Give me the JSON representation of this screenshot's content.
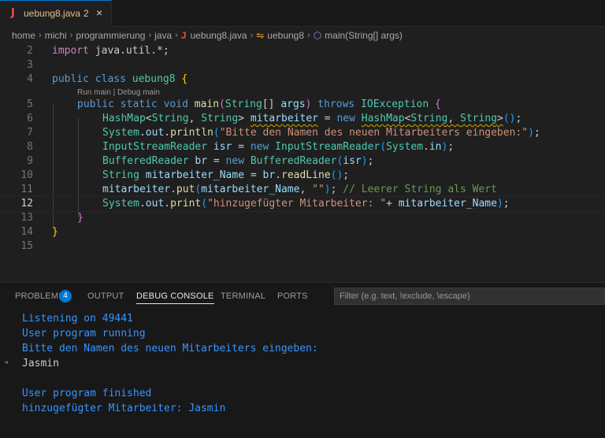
{
  "tab": {
    "icon": "J",
    "label": "uebung8.java",
    "badge": "2",
    "close": "×"
  },
  "breadcrumb": {
    "items": [
      "home",
      "michi",
      "programmierung",
      "java"
    ],
    "file_icon": "J",
    "file": "uebung8.java",
    "class": "uebung8",
    "method": "main(String[] args)"
  },
  "editor": {
    "line_numbers": [
      "2",
      "3",
      "4",
      "5",
      "6",
      "7",
      "8",
      "9",
      "10",
      "11",
      "12",
      "13",
      "14",
      "15"
    ],
    "active_line": "12",
    "codelens": "Run main | Debug main"
  },
  "code": {
    "l2": {
      "kw": "import",
      "rest": " java.util.*;"
    },
    "l4": {
      "kw1": "public",
      "kw2": "class",
      "name": "uebung8",
      "br": "{"
    },
    "l5": {
      "kw1": "public",
      "kw2": "static",
      "kw3": "void",
      "fn": "main",
      "p1": "(",
      "ty": "String",
      "arr": "[] ",
      "va": "args",
      "p2": ")",
      "kw4": "throws",
      "ex": "IOException",
      "br": "{"
    },
    "l6": {
      "ty1": "HashMap",
      "g1": "<",
      "ty2": "String",
      "c": ", ",
      "ty3": "String",
      "g2": "> ",
      "va": "mitarbeiter",
      "eq": " = ",
      "kw": "new",
      "ty4": "HashMap",
      "g3": "<",
      "ty5": "String",
      "c2": ", ",
      "ty6": "String",
      "g4": ">",
      "p": "()",
      "end": ";"
    },
    "l7": {
      "ty": "System",
      "d1": ".",
      "va": "out",
      "d2": ".",
      "fn": "println",
      "p1": "(",
      "st": "\"Bitte den Namen des neuen Mitarbeiters eingeben:\"",
      "p2": ")",
      "end": ";"
    },
    "l8": {
      "ty": "InputStreamReader",
      "va": " isr",
      "eq": " = ",
      "kw": "new",
      "ty2": " InputStreamReader",
      "p1": "(",
      "ty3": "System",
      "d": ".",
      "va2": "in",
      "p2": ")",
      "end": ";"
    },
    "l9": {
      "ty": "BufferedReader",
      "va": " br",
      "eq": " = ",
      "kw": "new",
      "ty2": " BufferedReader",
      "p1": "(",
      "va2": "isr",
      "p2": ")",
      "end": ";"
    },
    "l10": {
      "ty": "String",
      "va": " mitarbeiter_Name",
      "eq": " = ",
      "va2": "br",
      "d": ".",
      "fn": "readLine",
      "p": "()",
      "end": ";"
    },
    "l11": {
      "va": "mitarbeiter",
      "d": ".",
      "fn": "put",
      "p1": "(",
      "va2": "mitarbeiter_Name",
      "c": ", ",
      "st": "\"\"",
      "p2": ")",
      "end": ";",
      "cm": " // Leerer String als Wert"
    },
    "l12": {
      "ty": "System",
      "d1": ".",
      "va": "out",
      "d2": ".",
      "fn": "print",
      "p1": "(",
      "st": "\"hinzugefügter Mitarbeiter: \"",
      "plus": "+ ",
      "va2": "mitarbeiter_Name",
      "p2": ")",
      "end": ";"
    },
    "l13": {
      "br": "}"
    },
    "l14": {
      "br": "}"
    }
  },
  "panel": {
    "tabs": [
      "PROBLEMS",
      "OUTPUT",
      "DEBUG CONSOLE",
      "TERMINAL",
      "PORTS"
    ],
    "problems_count": "4",
    "filter_placeholder": "Filter (e.g. text, !exclude, \\escape)",
    "console": [
      "Listening on 49441",
      "User program running",
      "Bitte den Namen des neuen Mitarbeiters eingeben:",
      "Jasmin",
      "User program finished",
      "hinzugefügter Mitarbeiter: Jasmin"
    ],
    "input_arrow": "➔"
  },
  "colors": {
    "accent": "#0078d4",
    "console_info": "#3794ff",
    "tab_modified": "#e2c08d"
  }
}
